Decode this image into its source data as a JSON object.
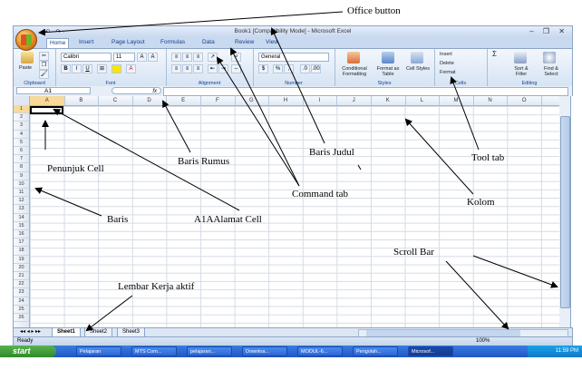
{
  "window": {
    "title": "Book1 [Compatibility Mode] - Microsoft Excel",
    "qat": "▪ ↶ · ↷ ·",
    "controls": "– ❐ ✕"
  },
  "ribbon": {
    "tabs": [
      "Home",
      "Insert",
      "Page Layout",
      "Formulas",
      "Data",
      "Review",
      "View"
    ],
    "groups": {
      "clipboard": {
        "label": "Clipboard",
        "paste": "Paste"
      },
      "font": {
        "label": "Font",
        "font_name": "Calibri",
        "font_size": "11",
        "bold": "B",
        "italic": "I",
        "underline": "U",
        "grow": "A",
        "shrink": "A"
      },
      "alignment": {
        "label": "Alignment"
      },
      "number": {
        "label": "Number",
        "format": "General",
        "currency": "$",
        "percent": "%",
        "comma": ","
      },
      "styles": {
        "label": "Styles",
        "conditional": "Conditional Formatting",
        "format_table": "Format as Table",
        "cell_styles": "Cell Styles"
      },
      "cells": {
        "label": "Cells",
        "insert": "Insert",
        "delete": "Delete",
        "format": "Format"
      },
      "editing": {
        "label": "Editing",
        "sigma": "Σ",
        "sort": "Sort & Filter",
        "find": "Find & Select"
      }
    }
  },
  "formula_bar": {
    "name_box": "A1",
    "fx": "fx",
    "content": ""
  },
  "grid": {
    "columns": [
      "A",
      "B",
      "C",
      "D",
      "E",
      "F",
      "G",
      "H",
      "I",
      "J",
      "K",
      "L",
      "M",
      "N",
      "O"
    ],
    "rows": [
      "1",
      "2",
      "3",
      "4",
      "5",
      "6",
      "7",
      "8",
      "9",
      "10",
      "11",
      "12",
      "13",
      "14",
      "15",
      "16",
      "17",
      "18",
      "19",
      "20",
      "21",
      "22",
      "23",
      "24",
      "25",
      "26"
    ],
    "active_cell": "A1"
  },
  "sheet_tabs": {
    "nav": "◂◂ ◂ ▸ ▸▸",
    "tabs": [
      "Sheet1",
      "Sheet2",
      "Sheet3"
    ],
    "active": "Sheet1"
  },
  "status_bar": {
    "ready": "Ready",
    "zoom": "100%"
  },
  "taskbar": {
    "start": "start",
    "items": [
      "Pelajaran",
      "MTS Com...",
      "pelajaran...",
      "Downloa...",
      "MODUL-6...",
      "Pengolah...",
      "Microsof..."
    ],
    "clock": "11:59 PM"
  },
  "annotations": {
    "office_button": "Office button",
    "penunjuk_cell": "Penunjuk Cell",
    "baris_rumus": "Baris Rumus",
    "baris_judul": "Baris Judul",
    "tool_tab": "Tool tab",
    "command_tab": "Command tab",
    "kolom": "Kolom",
    "baris": "Baris",
    "alamat_cell": "A1AAlamat Cell",
    "scroll_bar": "Scroll Bar",
    "lembar_kerja": "Lembar Kerja aktif"
  }
}
